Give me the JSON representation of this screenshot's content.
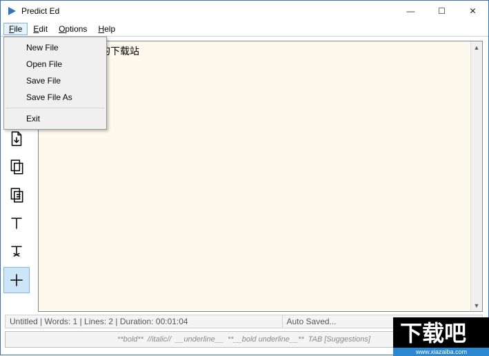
{
  "app": {
    "title": "Predict Ed"
  },
  "menu": {
    "file": "File",
    "edit": "Edit",
    "options": "Options",
    "help": "Help"
  },
  "file_menu": {
    "new": "New File",
    "open": "Open File",
    "save": "Save File",
    "saveas": "Save File As",
    "exit": "Exit"
  },
  "editor": {
    "content": "一款绿色安全的下载站"
  },
  "status": {
    "left": "Untitled | Words: 1 | Lines: 2 | Duration: 00:01:04",
    "right": "Auto Saved..."
  },
  "hint": {
    "bold": "**bold**",
    "italic": "//italic//",
    "under": "__underline__",
    "bu": "**__bold underline__**",
    "tab": "TAB [Suggestions]"
  },
  "watermark": {
    "text": "下载吧",
    "url": "www.xiazaiba.com"
  }
}
